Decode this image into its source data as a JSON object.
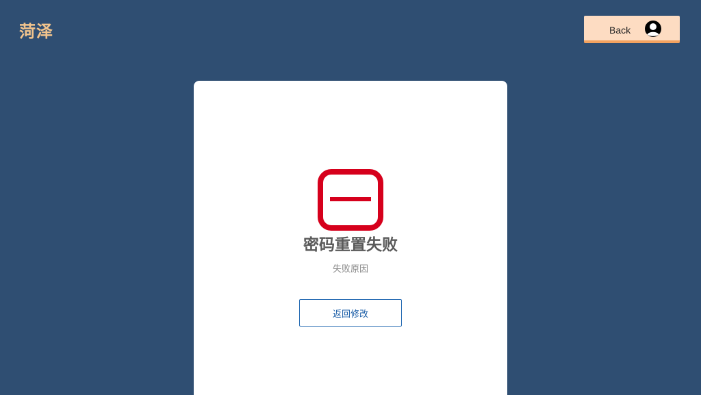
{
  "header": {
    "brand": "菏泽",
    "back_label": "Back",
    "back_icon": "user-circle-icon"
  },
  "card": {
    "status_icon": "fail-square-minus-icon",
    "title": "密码重置失败",
    "reason": "失败原因",
    "modify_button": "返回修改"
  },
  "colors": {
    "background": "#2f4e72",
    "brand": "#f2c48d",
    "back_button": "#fddcc2",
    "back_button_accent": "#f3a260",
    "fail_red": "#d6001c",
    "link_blue": "#1d5fa8"
  }
}
